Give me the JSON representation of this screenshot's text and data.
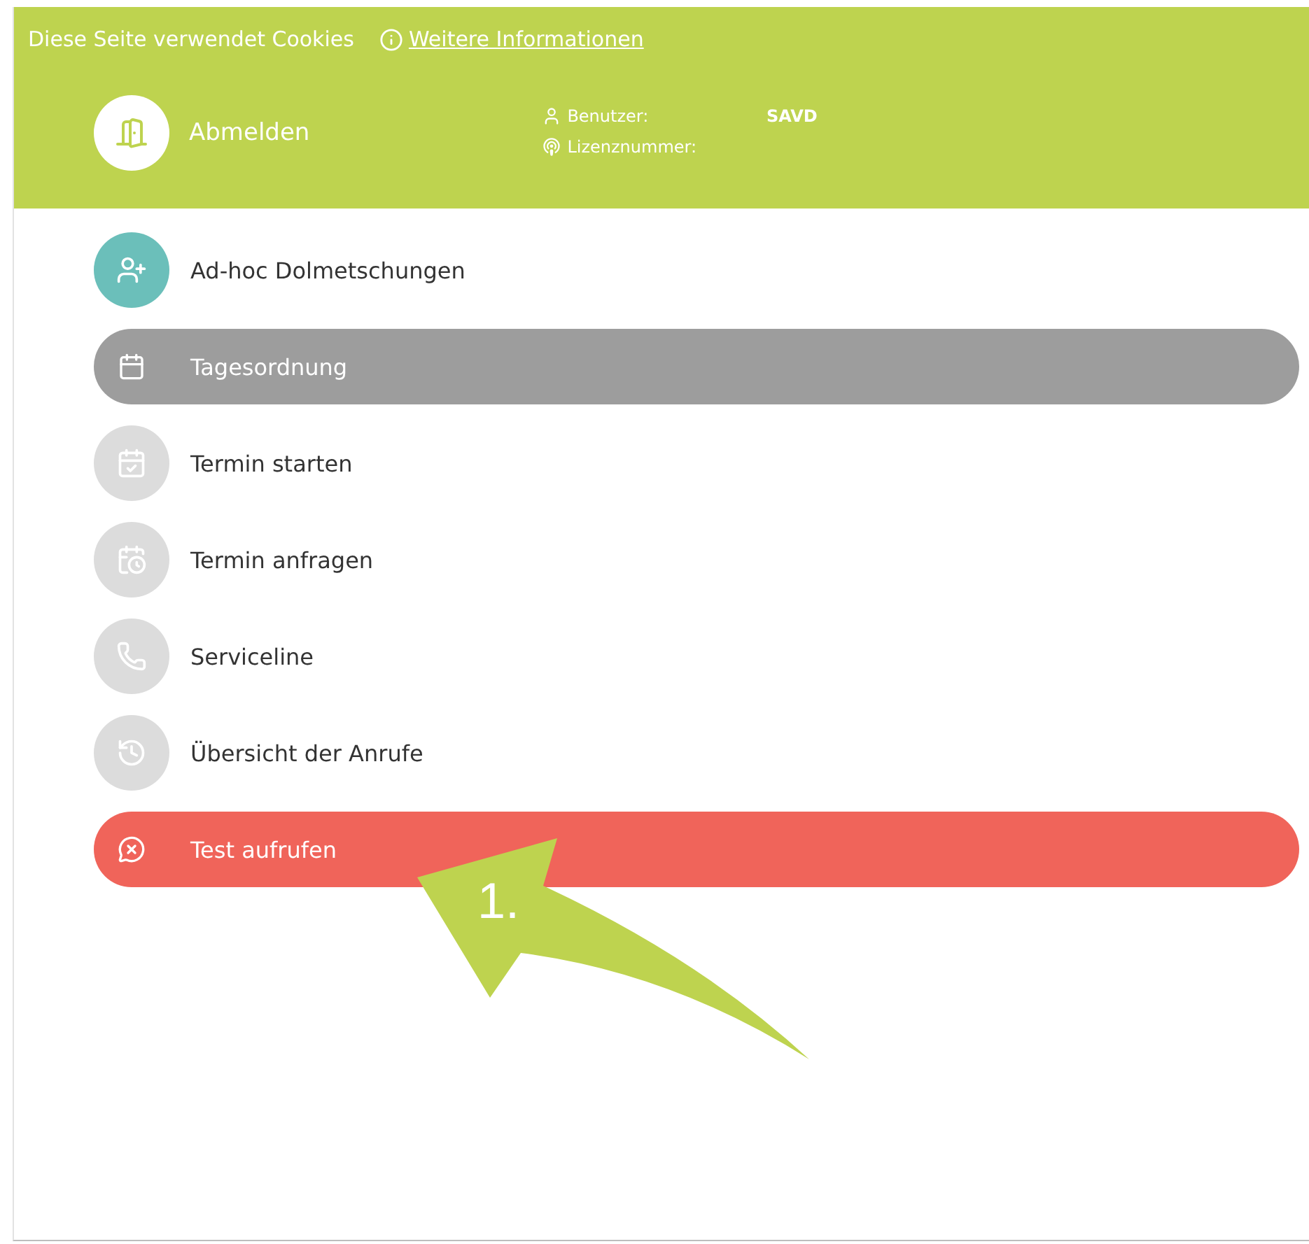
{
  "cookie_bar": {
    "text": "Diese Seite verwendet Cookies",
    "link": "Weitere Informationen"
  },
  "header": {
    "logout": "Abmelden",
    "user_label": "Benutzer:",
    "user_value": "SAVD",
    "license_label": "Lizenznummer:"
  },
  "menu": [
    {
      "label": "Ad-hoc Dolmetschungen",
      "kind": "circle",
      "color": "#6bbfba"
    },
    {
      "label": "Tagesordnung",
      "kind": "pill",
      "color": "#9d9d9d"
    },
    {
      "label": "Termin starten",
      "kind": "circle",
      "color": "#dcdcdc"
    },
    {
      "label": "Termin anfragen",
      "kind": "circle",
      "color": "#dcdcdc"
    },
    {
      "label": "Serviceline",
      "kind": "circle",
      "color": "#dcdcdc"
    },
    {
      "label": "Übersicht der Anrufe",
      "kind": "circle",
      "color": "#dcdcdc"
    },
    {
      "label": "Test aufrufen",
      "kind": "pill",
      "color": "#f0645a"
    }
  ],
  "annotation": {
    "label": "1."
  }
}
